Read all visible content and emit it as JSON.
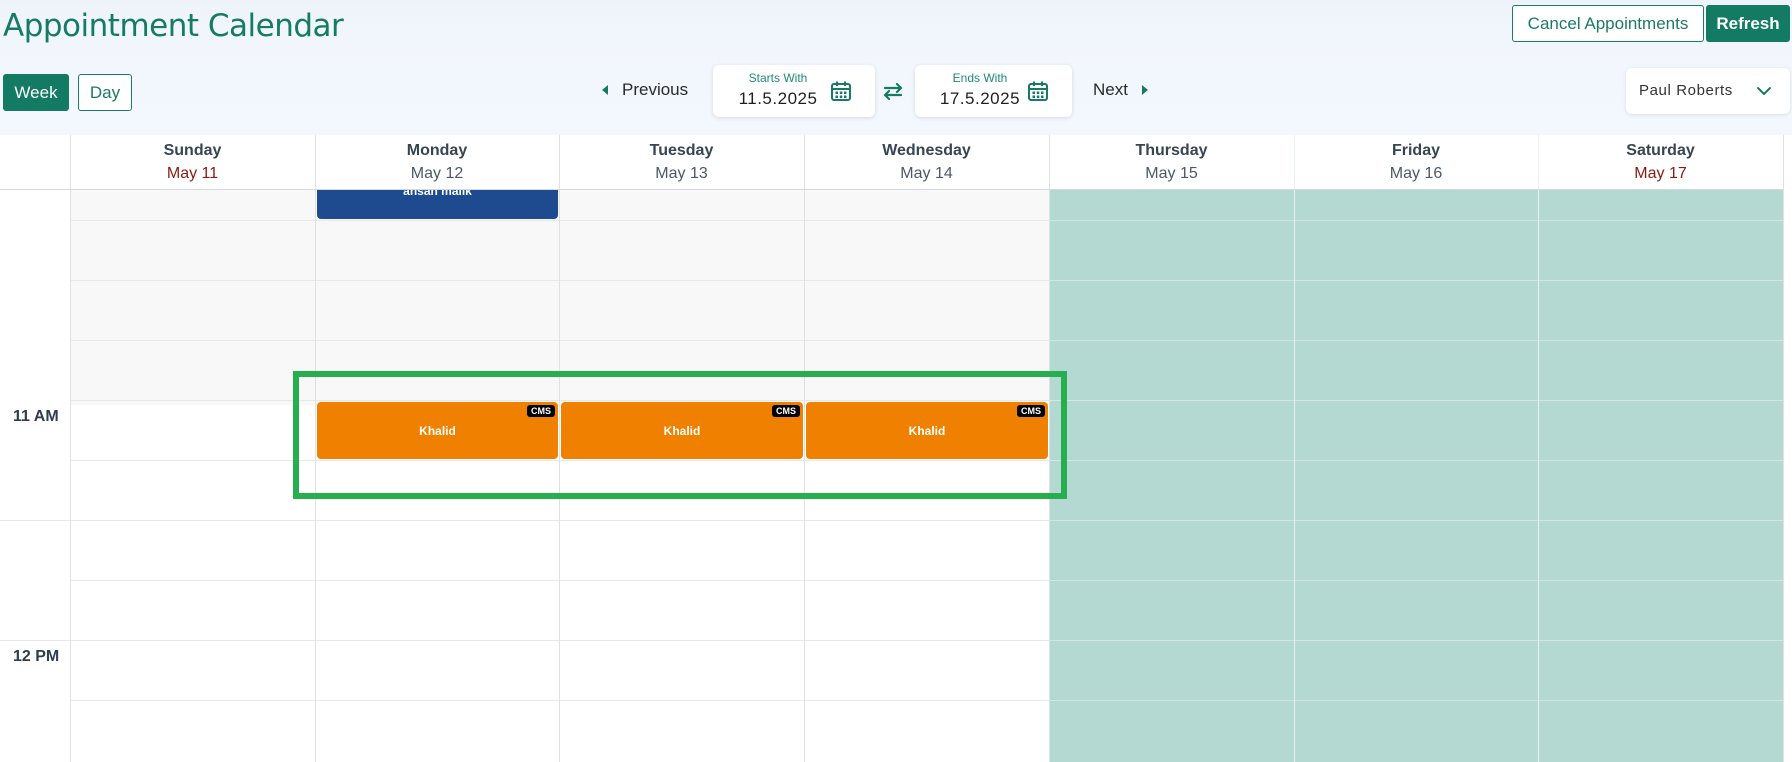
{
  "header": {
    "title": "Appointment Calendar",
    "cancel_label": "Cancel Appointments",
    "refresh_label": "Refresh"
  },
  "view_toggle": {
    "week_label": "Week",
    "day_label": "Day",
    "active": "Week"
  },
  "navigation": {
    "previous_label": "Previous",
    "next_label": "Next",
    "start": {
      "label": "Starts With",
      "value": "11.5.2025"
    },
    "end": {
      "label": "Ends With",
      "value": "17.5.2025"
    }
  },
  "provider": {
    "selected": "Paul Roberts"
  },
  "days": [
    {
      "name": "Sunday",
      "date": "May 11"
    },
    {
      "name": "Monday",
      "date": "May 12"
    },
    {
      "name": "Tuesday",
      "date": "May 13"
    },
    {
      "name": "Wednesday",
      "date": "May 14"
    },
    {
      "name": "Thursday",
      "date": "May 15"
    },
    {
      "name": "Friday",
      "date": "May 16"
    },
    {
      "name": "Saturday",
      "date": "May 17"
    }
  ],
  "time_labels": [
    "11 AM",
    "12 PM"
  ],
  "appointments": [
    {
      "day": "Monday",
      "name": "ahsan malik",
      "color": "#1e4b8f"
    },
    {
      "day": "Monday",
      "name": "Khalid",
      "badge": "CMS",
      "time": "11 AM",
      "color": "#f08000"
    },
    {
      "day": "Tuesday",
      "name": "Khalid",
      "badge": "CMS",
      "time": "11 AM",
      "color": "#f08000"
    },
    {
      "day": "Wednesday",
      "name": "Khalid",
      "badge": "CMS",
      "time": "11 AM",
      "color": "#f08000"
    }
  ],
  "colors": {
    "accent": "#137a64",
    "unavailable": "#b4d9d2",
    "weekend_date": "#8c1a12",
    "highlight": "#27ae4f"
  }
}
